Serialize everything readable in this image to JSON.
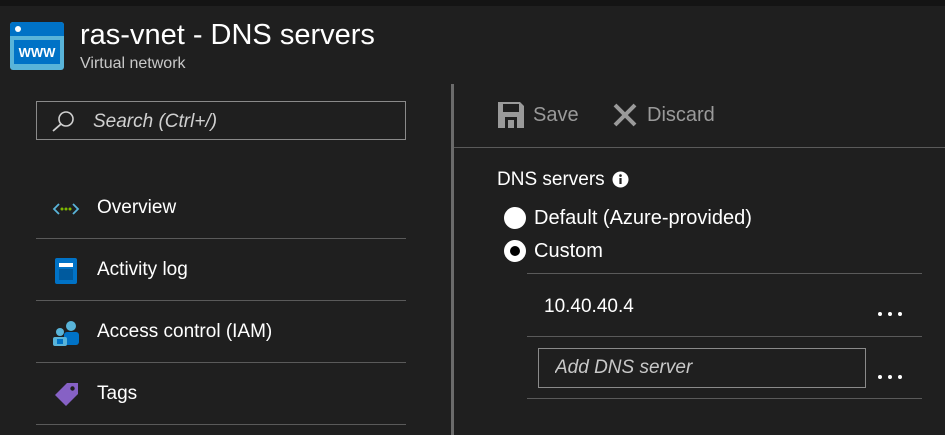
{
  "header": {
    "title": "ras-vnet - DNS servers",
    "subtitle": "Virtual network",
    "icon": "virtual-network-www-icon",
    "icon_text": "WWW"
  },
  "search": {
    "placeholder": "Search (Ctrl+/)",
    "icon": "search-icon"
  },
  "menu": {
    "items": [
      {
        "label": "Overview",
        "icon": "overview-icon"
      },
      {
        "label": "Activity log",
        "icon": "activity-log-icon"
      },
      {
        "label": "Access control (IAM)",
        "icon": "access-control-icon"
      },
      {
        "label": "Tags",
        "icon": "tag-icon"
      }
    ]
  },
  "toolbar": {
    "save_label": "Save",
    "discard_label": "Discard"
  },
  "dns": {
    "heading": "DNS servers",
    "options": [
      {
        "label": "Default (Azure-provided)",
        "selected": false
      },
      {
        "label": "Custom",
        "selected": true
      }
    ],
    "servers": [
      "10.40.40.4"
    ],
    "add_placeholder": "Add DNS server",
    "more_label": "..."
  },
  "colors": {
    "background": "#1f1f1f",
    "text": "#ffffff",
    "muted_text": "#9a9a9a",
    "border": "#8a8a8a",
    "divider": "#5a5a5a",
    "accent_blue": "#0072c6",
    "tag_purple": "#8661c5"
  }
}
